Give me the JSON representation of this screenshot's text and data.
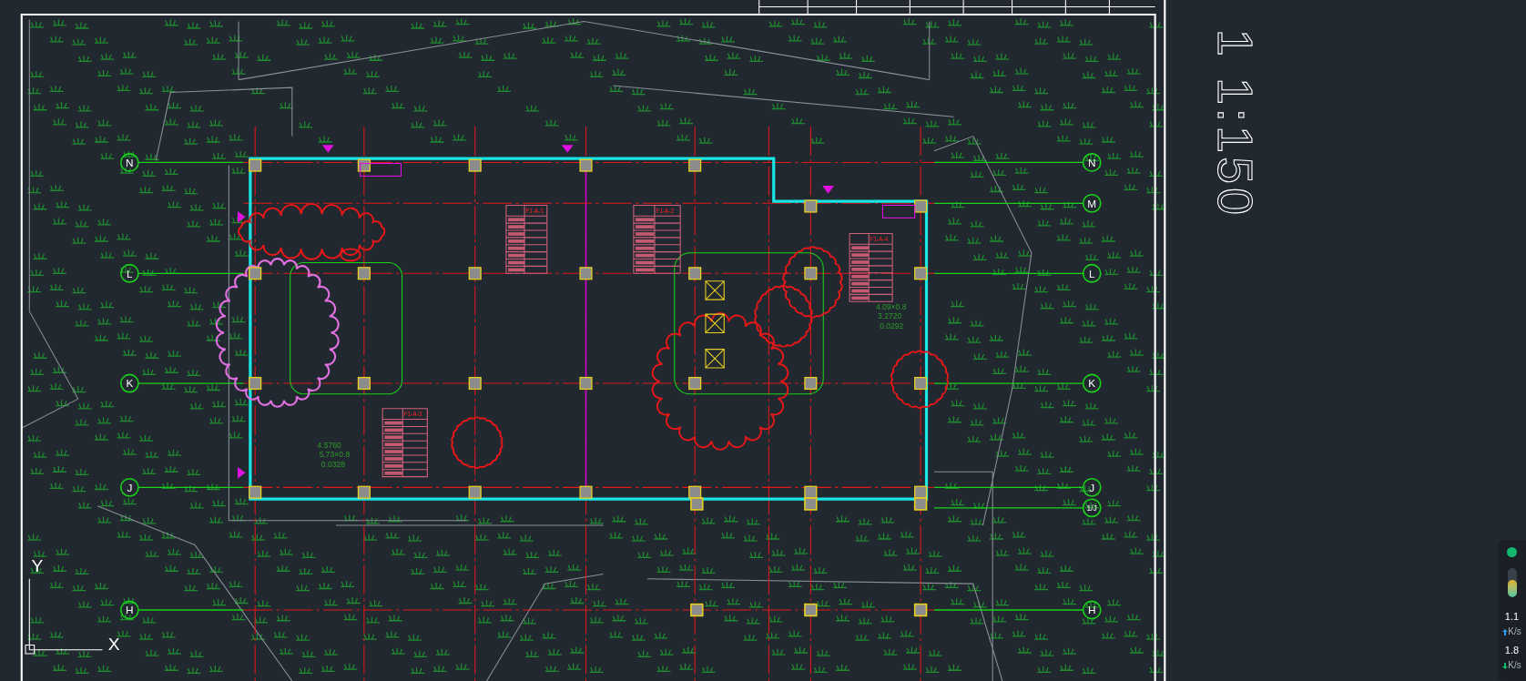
{
  "drawing": {
    "scale_label": "1 1:150",
    "grid_axes": [
      {
        "left_label": "N",
        "right_label": "N"
      },
      {
        "right_label": "M"
      },
      {
        "left_label": "L",
        "right_label": "L"
      },
      {
        "left_label": "K",
        "right_label": "K"
      },
      {
        "left_label": "J",
        "right_label": "J"
      },
      {
        "left_label": "H",
        "right_label": "H"
      }
    ],
    "extra_bubbles": [
      {
        "label": "1/J"
      }
    ],
    "room_tables": [
      {
        "title": "F1-A-1"
      },
      {
        "title": "F1-A-2"
      },
      {
        "title": "F1-A-3"
      },
      {
        "title": "F1-A-4"
      }
    ],
    "annotations": [
      {
        "lines": [
          "4.5760",
          "5.73×0.8",
          "0.0328"
        ]
      },
      {
        "lines": [
          "4.09×0.8",
          "3.2720",
          "0.0292"
        ]
      }
    ],
    "ucs": {
      "y": "Y",
      "x": "X"
    }
  },
  "net_monitor": {
    "level": 0.6,
    "upload": "1.1",
    "upload_unit": "K/s",
    "download": "1.8",
    "download_unit": "K/s"
  }
}
